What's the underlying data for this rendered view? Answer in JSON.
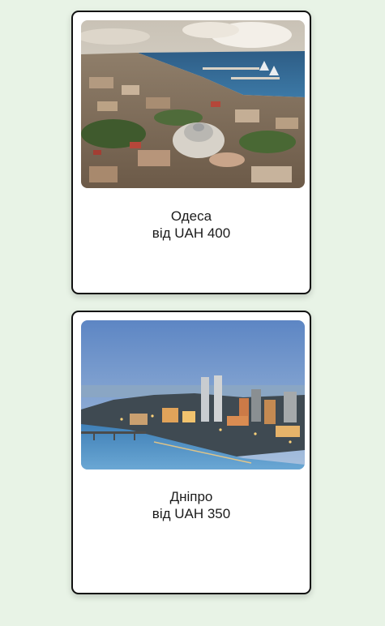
{
  "cards": [
    {
      "city": "Одеса",
      "price": "від UAH 400",
      "image": "odesa-aerial-photo"
    },
    {
      "city": "Дніпро",
      "price": "від UAH 350",
      "image": "dnipro-evening-skyline-photo"
    }
  ],
  "colors": {
    "page_background": "#e8f3e6",
    "card_background": "#ffffff",
    "card_border": "#111111"
  }
}
